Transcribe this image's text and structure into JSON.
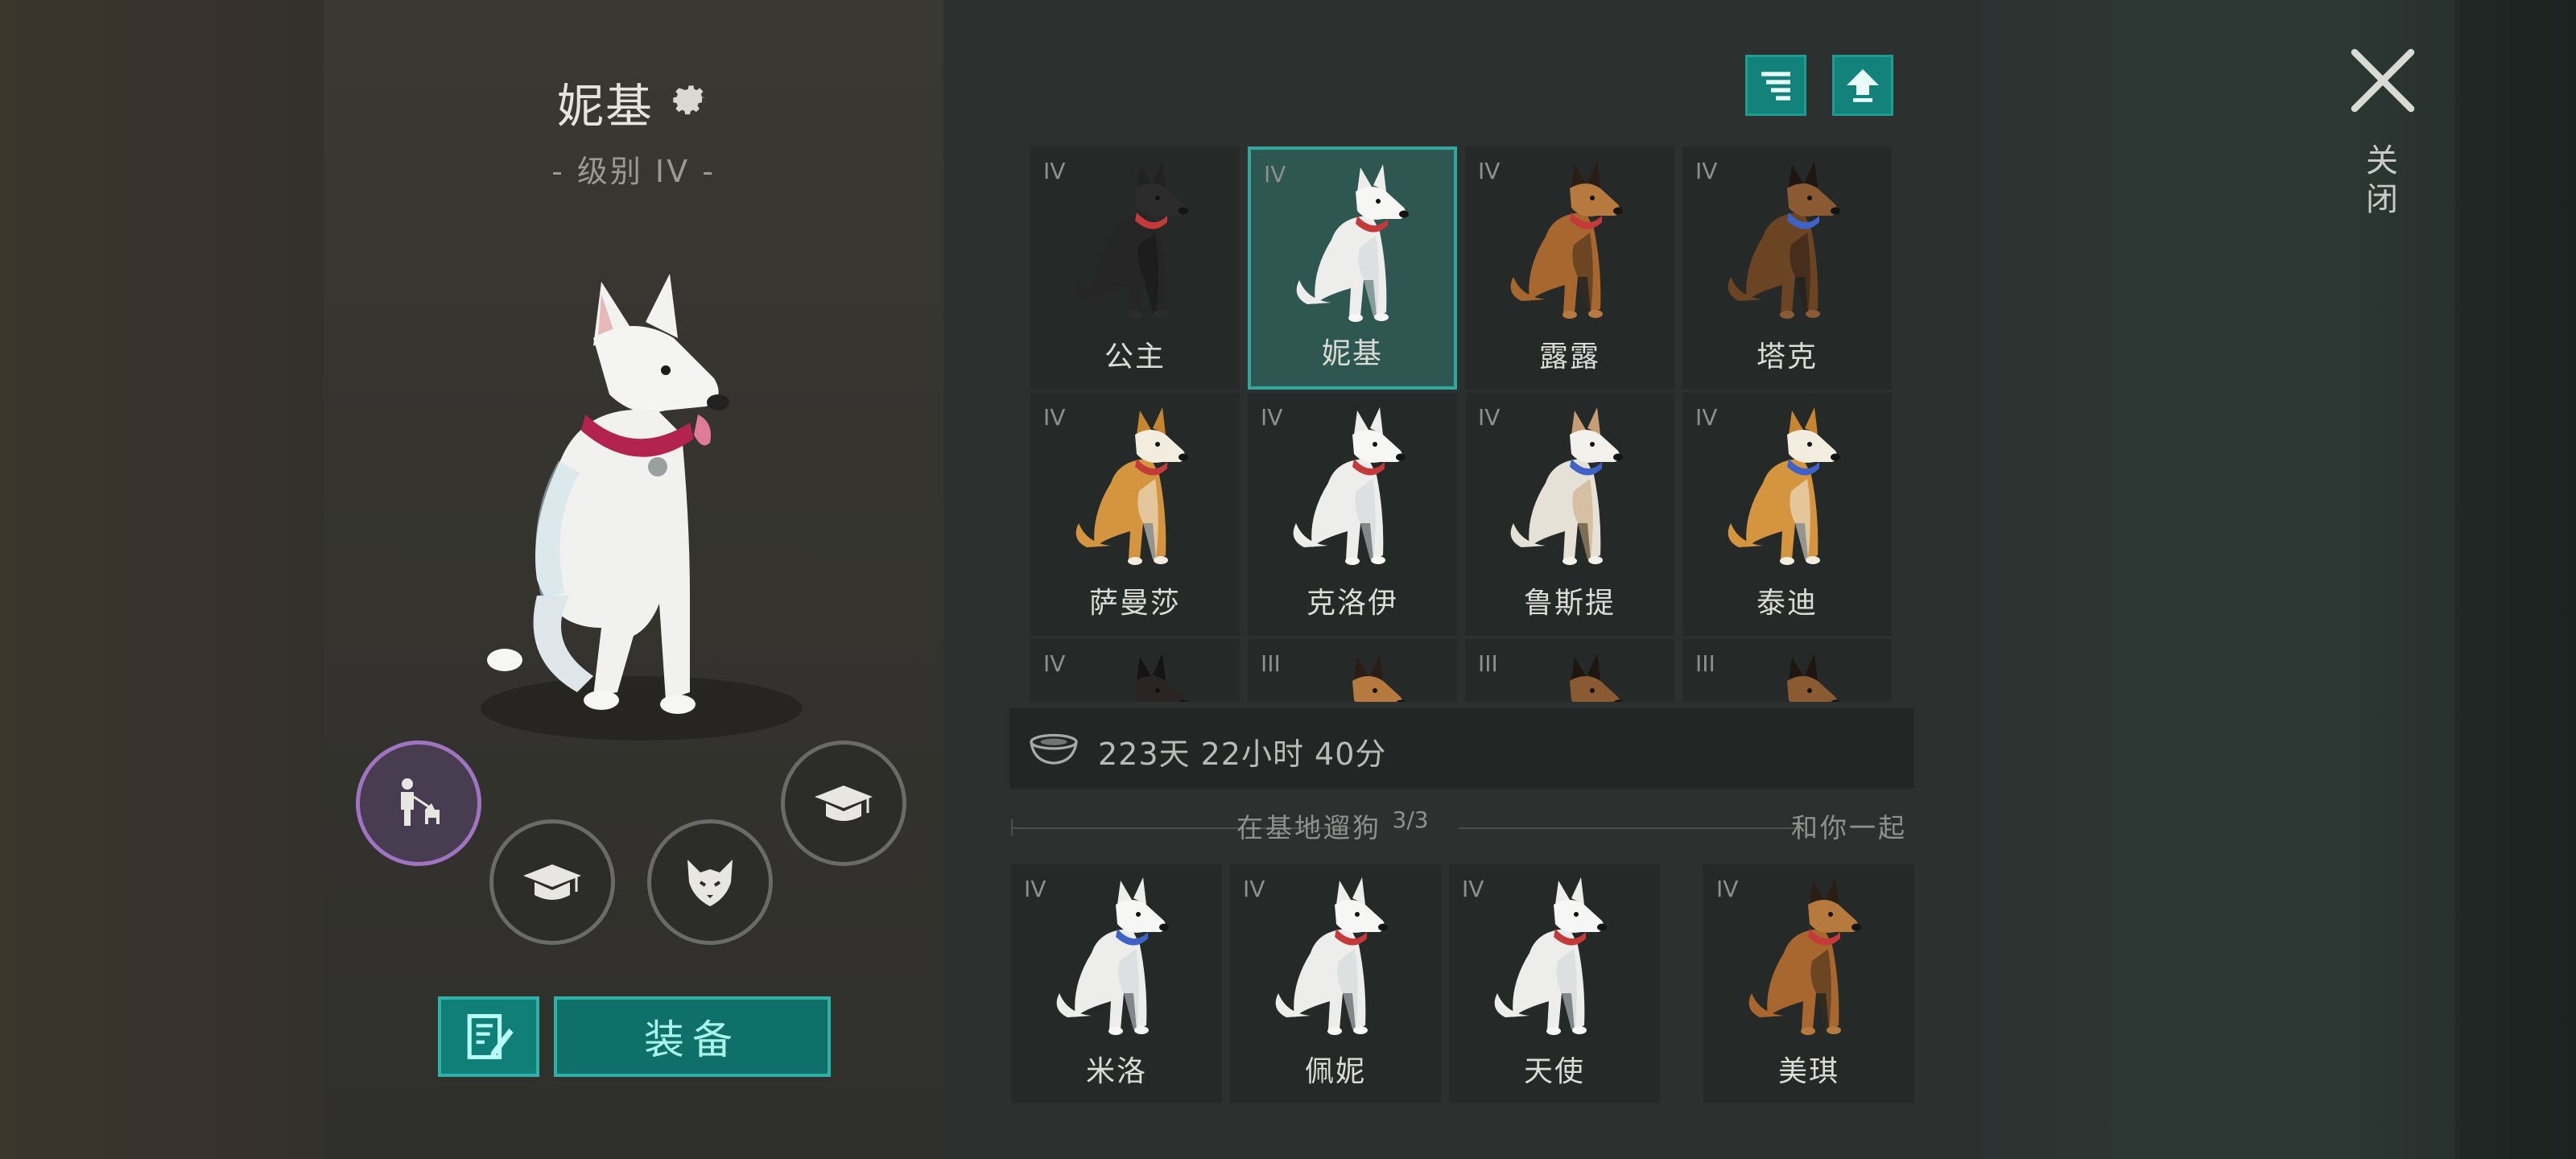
{
  "selected_dog": {
    "name": "妮基",
    "level_text": "- 级别 IV -"
  },
  "left_actions": {
    "training_icon": "dog-handler-icon",
    "skill_icon_1": "graduation-cap-icon",
    "skill_icon_2": "wolf-head-icon",
    "skill_icon_3": "graduation-cap-icon",
    "notes_icon": "notepad-pencil-icon",
    "equip_label": "装备"
  },
  "toolbar": {
    "sort_icon": "sort-lines-icon",
    "upgrade_icon": "arrow-up-icon"
  },
  "dog_grid": [
    {
      "tier": "IV",
      "name": "公主",
      "breed": "black-shepherd",
      "collar": "#c43a3a",
      "selected": false
    },
    {
      "tier": "IV",
      "name": "妮基",
      "breed": "white-shepherd",
      "collar": "#c43a3a",
      "selected": true
    },
    {
      "tier": "IV",
      "name": "露露",
      "breed": "german-shepherd",
      "collar": "#c43a3a",
      "selected": false
    },
    {
      "tier": "IV",
      "name": "塔克",
      "breed": "german-shepherd-dark",
      "collar": "#3f62c8",
      "selected": false
    },
    {
      "tier": "IV",
      "name": "萨曼莎",
      "breed": "shiba",
      "collar": "#c43a3a",
      "selected": false
    },
    {
      "tier": "IV",
      "name": "克洛伊",
      "breed": "white-shepherd",
      "collar": "#c43a3a",
      "selected": false
    },
    {
      "tier": "IV",
      "name": "鲁斯提",
      "breed": "husky-tan",
      "collar": "#3f62c8",
      "selected": false
    },
    {
      "tier": "IV",
      "name": "泰迪",
      "breed": "shiba",
      "collar": "#3f62c8",
      "selected": false
    },
    {
      "tier": "IV",
      "name": "",
      "breed": "rottweiler",
      "collar": "#c43a3a",
      "selected": false
    },
    {
      "tier": "III",
      "name": "",
      "breed": "german-shepherd",
      "collar": "#c43a3a",
      "selected": false
    },
    {
      "tier": "III",
      "name": "",
      "breed": "german-shepherd-dark",
      "collar": "#c43a3a",
      "selected": false
    },
    {
      "tier": "III",
      "name": "",
      "breed": "german-shepherd-dark",
      "collar": "#c43a3a",
      "selected": false
    }
  ],
  "timer": {
    "icon": "food-bowl-icon",
    "text": "223天 22小时 40分"
  },
  "base_section": {
    "label": "在基地遛狗",
    "count": "3/3",
    "dogs": [
      {
        "tier": "IV",
        "name": "米洛",
        "breed": "white-shepherd",
        "collar": "#3f62c8"
      },
      {
        "tier": "IV",
        "name": "佩妮",
        "breed": "white-shepherd",
        "collar": "#c43a3a"
      },
      {
        "tier": "IV",
        "name": "天使",
        "breed": "white-shepherd",
        "collar": "#c43a3a"
      }
    ]
  },
  "with_you_section": {
    "label": "和你一起",
    "dogs": [
      {
        "tier": "IV",
        "name": "美琪",
        "breed": "german-shepherd",
        "collar": "#c43a3a"
      }
    ]
  },
  "close": {
    "icon": "close-x-icon",
    "label": "关闭"
  }
}
